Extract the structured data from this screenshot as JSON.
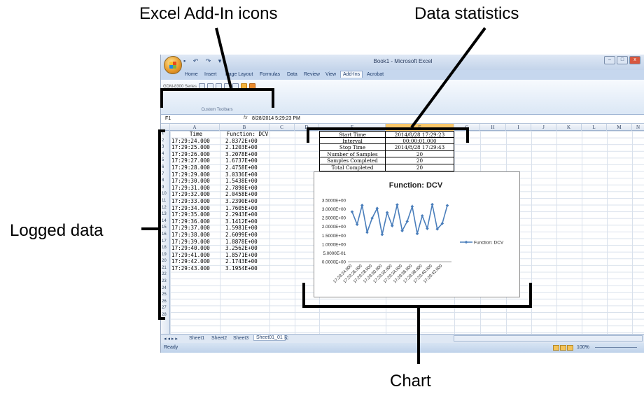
{
  "callouts": {
    "addin_icons": "Excel Add-In icons",
    "data_statistics": "Data statistics",
    "logged_data": "Logged data",
    "chart": "Chart"
  },
  "window": {
    "title": "Book1 - Microsoft Excel",
    "min_btn": "–",
    "max_btn": "□",
    "close_btn": "x"
  },
  "ribbon": {
    "tabs": [
      "Home",
      "Insert",
      "Page Layout",
      "Formulas",
      "Data",
      "Review",
      "View",
      "Add-Ins",
      "Acrobat"
    ],
    "active_tab": "Add-Ins",
    "toolbar_name": "GDM-8300 Series",
    "group_label": "Custom Toolbars"
  },
  "formula_bar": {
    "cell_ref": "F1",
    "fx": "fx",
    "value": "8/28/2014  5:29:23 PM"
  },
  "columns": [
    "A",
    "B",
    "C",
    "D",
    "E",
    "F",
    "G",
    "H",
    "I",
    "J",
    "K",
    "L",
    "M",
    "N"
  ],
  "selected_column": "F",
  "rows": [
    "1",
    "2",
    "3",
    "4",
    "5",
    "6",
    "7",
    "8",
    "9",
    "10",
    "11",
    "12",
    "13",
    "14",
    "15",
    "16",
    "17",
    "18",
    "19",
    "20",
    "21",
    "22",
    "23",
    "24",
    "25",
    "26",
    "27",
    "28"
  ],
  "logged": {
    "header_time": "Time",
    "header_value": "Function: DCV",
    "time": [
      "17:29:24.000",
      "17:29:25.000",
      "17:29:26.000",
      "17:29:27.000",
      "17:29:28.000",
      "17:29:29.000",
      "17:29:30.000",
      "17:29:31.000",
      "17:29:32.000",
      "17:29:33.000",
      "17:29:34.000",
      "17:29:35.000",
      "17:29:36.000",
      "17:29:37.000",
      "17:29:38.000",
      "17:29:39.000",
      "17:29:40.000",
      "17:29:41.000",
      "17:29:42.000",
      "17:29:43.000"
    ],
    "value": [
      "2.8372E+00",
      "2.1203E+00",
      "3.2078E+00",
      "1.6737E+00",
      "2.4758E+00",
      "3.0336E+00",
      "1.5438E+00",
      "2.7898E+00",
      "2.0458E+00",
      "3.2390E+00",
      "1.7605E+00",
      "2.2943E+00",
      "3.1412E+00",
      "1.5981E+00",
      "2.6099E+00",
      "1.8878E+00",
      "3.2562E+00",
      "1.8571E+00",
      "2.1743E+00",
      "3.1954E+00"
    ]
  },
  "stats": [
    {
      "label": "Start Time",
      "value": "2014/8/28 17:29:23"
    },
    {
      "label": "Interval",
      "value": "00:00:01.000"
    },
    {
      "label": "Stop Time",
      "value": "2014/8/28 17:29:43"
    },
    {
      "label": "Number of Samples",
      "value": "20"
    },
    {
      "label": "Samples Completed",
      "value": "20"
    },
    {
      "label": "Total Completed",
      "value": "20"
    }
  ],
  "sheets": {
    "nav": "◂ ◂ ▸ ▸",
    "names": [
      "Sheet1",
      "Sheet2",
      "Sheet3",
      "Sheet01_01"
    ],
    "active": "Sheet01_01"
  },
  "status": {
    "ready": "Ready",
    "zoom": "100%"
  },
  "chart_data": {
    "type": "line",
    "title": "Function: DCV",
    "series": [
      {
        "name": "Function: DCV",
        "values": [
          2.8372,
          2.1203,
          3.2078,
          1.6737,
          2.4758,
          3.0336,
          1.5438,
          2.7898,
          2.0458,
          3.239,
          1.7605,
          2.2943,
          3.1412,
          1.5981,
          2.6099,
          1.8878,
          3.2562,
          1.8571,
          2.1743,
          3.1954
        ]
      }
    ],
    "x": [
      "17:29:24.000",
      "17:29:25.000",
      "17:29:26.000",
      "17:29:27.000",
      "17:29:28.000",
      "17:29:29.000",
      "17:29:30.000",
      "17:29:31.000",
      "17:29:32.000",
      "17:29:33.000",
      "17:29:34.000",
      "17:29:35.000",
      "17:29:36.000",
      "17:29:37.000",
      "17:29:38.000",
      "17:29:39.000",
      "17:29:40.000",
      "17:29:41.000",
      "17:29:42.000",
      "17:29:43.000"
    ],
    "x_tick_labels": [
      "17:29:24.000",
      "17:29:26.000",
      "17:29:28.000",
      "17:29:30.000",
      "17:29:32.000",
      "17:29:34.000",
      "17:29:36.000",
      "17:29:38.000",
      "17:29:40.000",
      "17:29:42.000"
    ],
    "y_tick_labels": [
      "0.0000E+00",
      "5.0000E-01",
      "1.0000E+00",
      "1.5000E+00",
      "2.0000E+00",
      "2.5000E+00",
      "3.0000E+00",
      "3.5000E+00"
    ],
    "ylim": [
      0,
      3.5
    ],
    "legend": "right",
    "color": "#4a7ebb"
  }
}
